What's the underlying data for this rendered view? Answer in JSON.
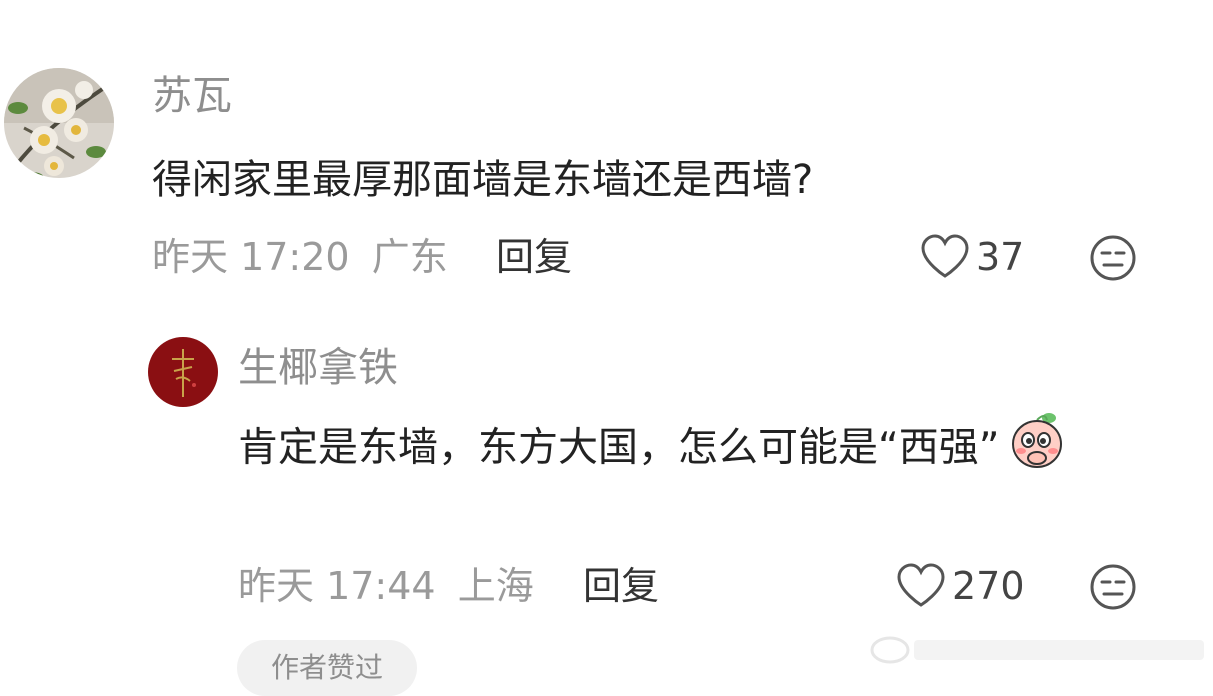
{
  "comments": [
    {
      "author": "苏瓦",
      "text": "得闲家里最厚那面墙是东墙还是西墙?",
      "time": "昨天 17:20",
      "location": "广东",
      "reply_label": "回复",
      "likes": "37",
      "avatar_icon": "flower-avatar"
    },
    {
      "author": "生椰拿铁",
      "text": "肯定是东墙，东方大国，怎么可能是“西强”",
      "time": "昨天 17:44",
      "location": "上海",
      "reply_label": "回复",
      "likes": "270",
      "avatar_icon": "calligraphy-avatar",
      "sticker_icon": "peach-giggle-sticker",
      "badge": "作者赞过"
    }
  ],
  "colors": {
    "name": "#8e8e8e",
    "meta": "#9a9a9a",
    "text": "#222222",
    "reply": "#333333",
    "avatar2_bg": "#8a0f12",
    "pill_bg": "#f1f1f1"
  }
}
